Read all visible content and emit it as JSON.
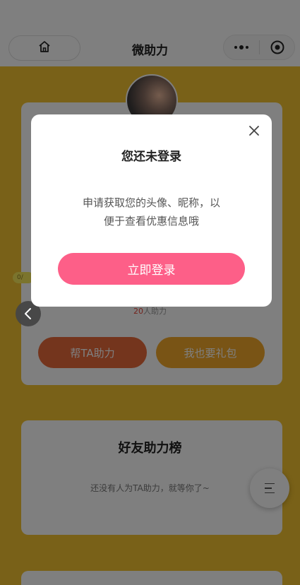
{
  "navbar": {
    "title": "微助力",
    "home_icon": "home-icon",
    "more_icon": "more-dots-icon",
    "close_icon": "target-close-icon"
  },
  "main_card": {
    "progress_tag": "0/",
    "helpers_count": "20",
    "helpers_suffix": "人助力",
    "help_button": "帮TA助力",
    "gift_button": "我也要礼包"
  },
  "rank_card": {
    "title": "好友助力榜",
    "empty_text": "还没有人为TA助力，就等你了~"
  },
  "login_modal": {
    "title": "您还未登录",
    "description_line1": "申请获取您的头像、昵称，以",
    "description_line2": "便于查看优惠信息哦",
    "login_button": "立即登录"
  },
  "colors": {
    "page_background": "#f2c230",
    "login_button": "#fd5f88",
    "help_button": "#e86a3a",
    "gift_button": "#f2a82a"
  }
}
